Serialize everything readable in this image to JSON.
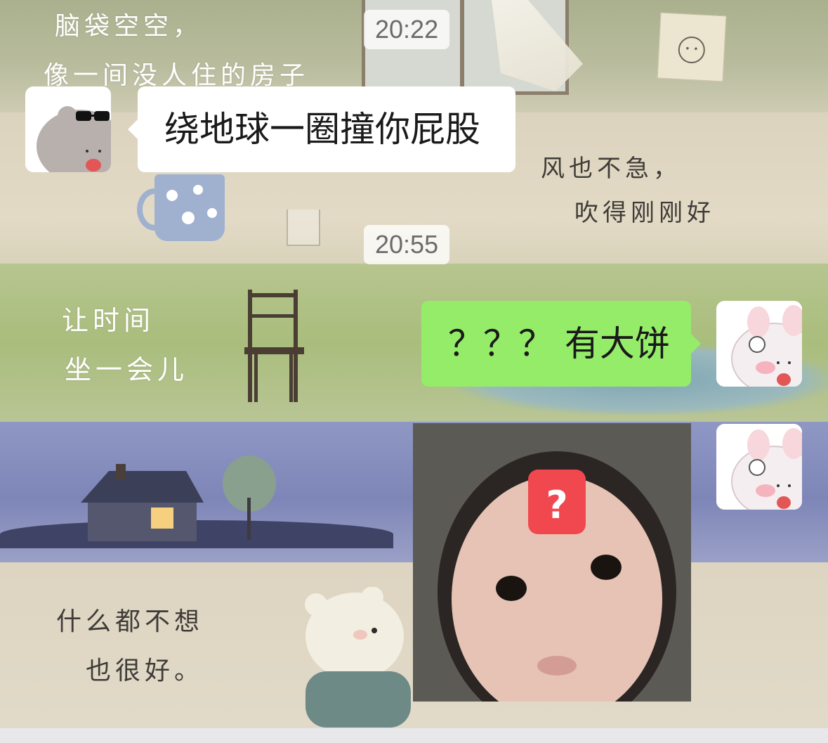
{
  "wallpaper": {
    "line1": "脑袋空空，",
    "line2": "像一间没人住的房子",
    "line3": "风也不急，",
    "line4": "吹得刚刚好",
    "line5": "让时间",
    "line6": "坐一会儿",
    "line7": "什么都不想",
    "line8": "也很好。"
  },
  "chat": {
    "timestamp_1": "20:22",
    "timestamp_2": "20:55",
    "msg_1": "绕地球一圈撞你屁股",
    "msg_2": "？？？ 有大饼",
    "sticker_badge": "?"
  },
  "colors": {
    "bubble_sent": "#95ec69",
    "bubble_received": "#ffffff",
    "sticker_badge": "#f1484f"
  },
  "icons": [
    "sunglasses-hamster-avatar",
    "pink-bunny-avatar",
    "pink-bunny-avatar",
    "confused-baby-sticker"
  ]
}
